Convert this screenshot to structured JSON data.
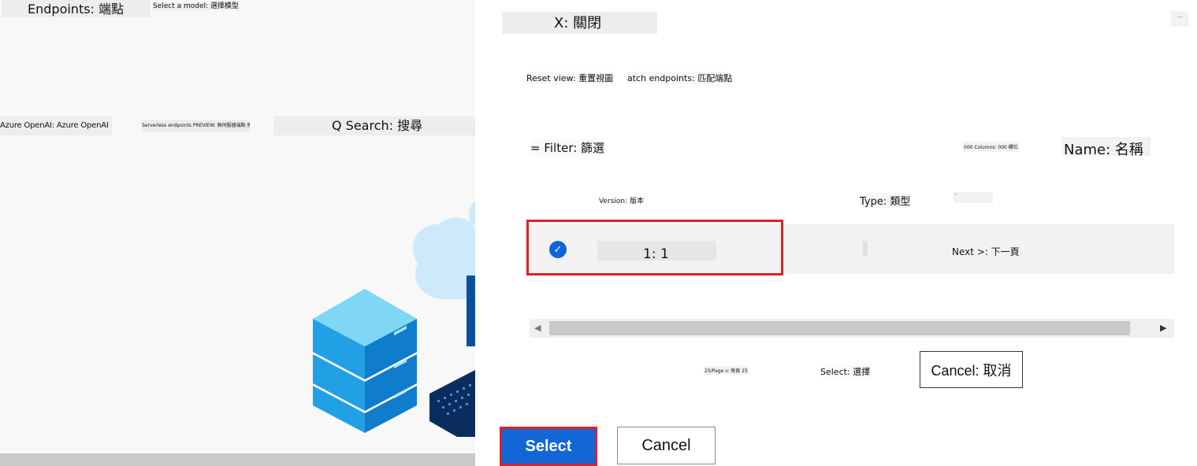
{
  "left": {
    "endpoints_tab": "Endpoints: 端點",
    "select_model": "Select a model: 選擇模型",
    "azure_openai": "Azure OpenAI: Azure OpenAI",
    "serverless": "Serverless endpoints PREVIEW: 無伺服器端點 預",
    "search": "Q Search: 搜尋"
  },
  "panel": {
    "close": "X: 關閉",
    "corner_label": "···",
    "reset_view": "Reset view: 重置視圖",
    "match_endpoints": "atch endpoints: 匹配端點",
    "filter": "= Filter: 篩選",
    "columns": "000 Columns: 000 欄位",
    "name_header": "Name: 名稱",
    "version_header": "Version: 版本",
    "type_header": "Type: 類型",
    "extra_header": "···",
    "row": {
      "check_glyph": "✓",
      "version_value": "1: 1",
      "next": "Next >: 下一頁"
    },
    "scroll": {
      "left_arrow": "◀",
      "right_arrow": "▶"
    },
    "per_page": "25/Page v: 每頁 25",
    "select_zh": "Select: 選擇",
    "cancel_zh": "Cancel: 取消"
  },
  "footer": {
    "select": "Select",
    "cancel": "Cancel"
  },
  "colors": {
    "primary": "#1366d6",
    "highlight": "#e01f26"
  }
}
